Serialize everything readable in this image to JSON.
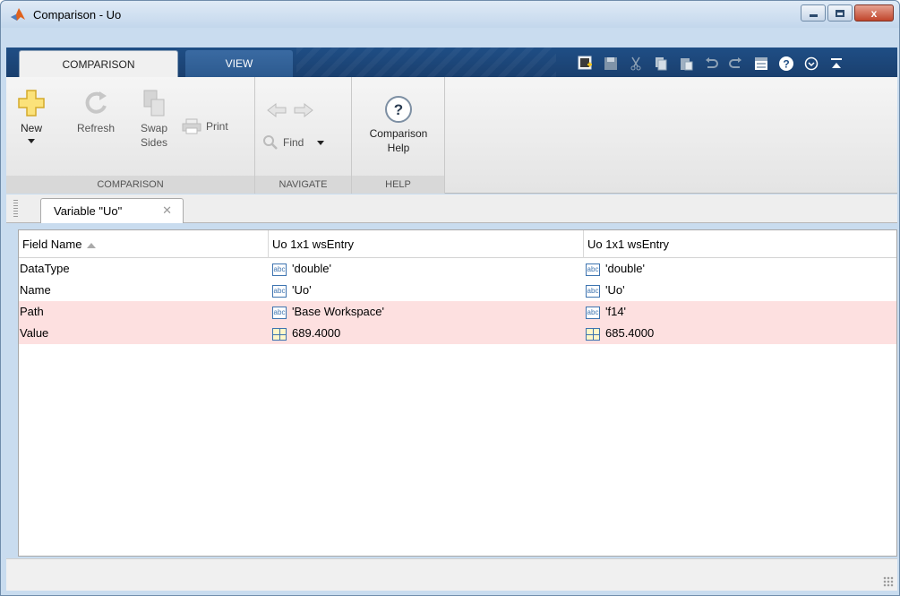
{
  "window": {
    "title": "Comparison - Uo",
    "minimize_glyph": "",
    "close_glyph": "x"
  },
  "toolstrip": {
    "tabs": [
      {
        "label": "COMPARISON",
        "active": true
      },
      {
        "label": "VIEW",
        "active": false
      }
    ],
    "quick_access_icons": [
      "new-window-icon",
      "save-icon",
      "cut-icon",
      "copy-icon",
      "paste-icon",
      "undo-icon",
      "redo-icon",
      "switch-windows-icon",
      "help-icon",
      "options-icon",
      "collapse-icon"
    ]
  },
  "ribbon": {
    "groups": [
      {
        "label": "COMPARISON"
      },
      {
        "label": "NAVIGATE"
      },
      {
        "label": "HELP"
      }
    ],
    "new_label": "New",
    "refresh_label": "Refresh",
    "swap_label_1": "Swap",
    "swap_label_2": "Sides",
    "print_label": "Print",
    "find_label": "Find",
    "help_label_1": "Comparison",
    "help_label_2": "Help"
  },
  "document_tab": {
    "label": "Variable \"Uo\"",
    "close_glyph": "✕"
  },
  "table": {
    "columns": [
      "Field Name",
      "Uo 1x1 wsEntry",
      "Uo 1x1 wsEntry"
    ],
    "rows": [
      {
        "field": "DataType",
        "left": "'double'",
        "right": "'double'",
        "type": "text",
        "diff": false
      },
      {
        "field": "Name",
        "left": "'Uo'",
        "right": "'Uo'",
        "type": "text",
        "diff": false
      },
      {
        "field": "Path",
        "left": "'Base Workspace'",
        "right": "'f14'",
        "type": "text",
        "diff": true
      },
      {
        "field": "Value",
        "left": "689.4000",
        "right": "685.4000",
        "type": "numeric",
        "diff": true
      }
    ],
    "text_icon_label": "abc"
  },
  "colors": {
    "diff_row": "#fde0e0",
    "toolstrip_blue": "#1f4e85",
    "accent_blue": "#3e74b0"
  }
}
